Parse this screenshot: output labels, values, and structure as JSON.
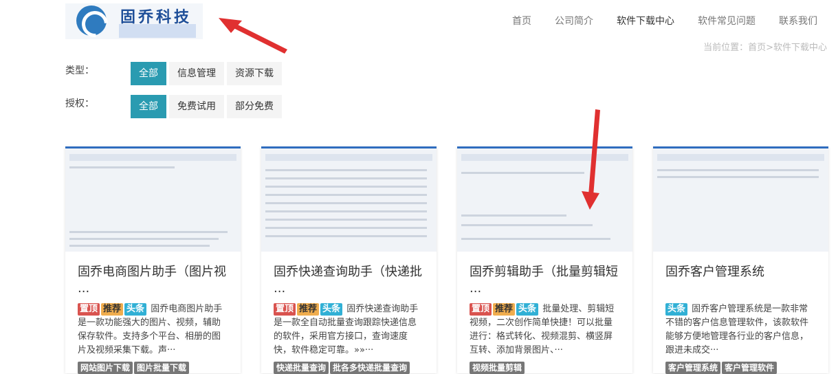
{
  "brand": {
    "name": "固乔科技"
  },
  "nav": [
    {
      "label": "首页"
    },
    {
      "label": "公司简介"
    },
    {
      "label": "软件下载中心"
    },
    {
      "label": "软件常见问题"
    },
    {
      "label": "联系我们"
    }
  ],
  "breadcrumb": "当前位置：首页>软件下载中心",
  "filters": {
    "type": {
      "label": "类型：",
      "options": [
        "全部",
        "信息管理",
        "资源下载"
      ]
    },
    "license": {
      "label": "授权：",
      "options": [
        "全部",
        "免费试用",
        "部分免费"
      ]
    }
  },
  "colors": {
    "accent": "#2a9bb1",
    "arrow": "#e03030"
  },
  "cards": [
    {
      "title": "固乔电商图片助手（图片视 ...",
      "badges": [
        "置顶",
        "推荐",
        "头条"
      ],
      "desc": "固乔电商图片助手是一款功能强大的图片、视频，辅助保存软件。支持多个平台、相册的图片及视频采集下载。声···",
      "tags": [
        "网站图片下载",
        "图片批量下载"
      ]
    },
    {
      "title": "固乔快递查询助手（快递批 ...",
      "badges": [
        "置顶",
        "推荐",
        "头条"
      ],
      "desc": "固乔快递查询助手是一款全自动批量查询跟踪快递信息的软件，采用官方接口，查询速度快，软件稳定可靠。»»···",
      "tags": [
        "快递批量查询",
        "批各多快递批量查询"
      ]
    },
    {
      "title": "固乔剪辑助手（批量剪辑短 ...",
      "badges": [
        "置顶",
        "推荐",
        "头条"
      ],
      "desc": "批量处理、剪辑短视频，二次创作简单快捷！可以批量进行：格式转化、视频混剪、横竖屏互转、添加背景图片、···",
      "tags": [
        "视频批量剪辑"
      ]
    },
    {
      "title": "固乔客户管理系统",
      "badges": [
        "头条"
      ],
      "desc": "固乔客户管理系统是一款非常不错的客户信息管理软件，该款软件能够方便地管理各行业的客户信息，跟进未成交···",
      "tags": [
        "客户管理系统",
        "客户管理软件"
      ]
    }
  ]
}
